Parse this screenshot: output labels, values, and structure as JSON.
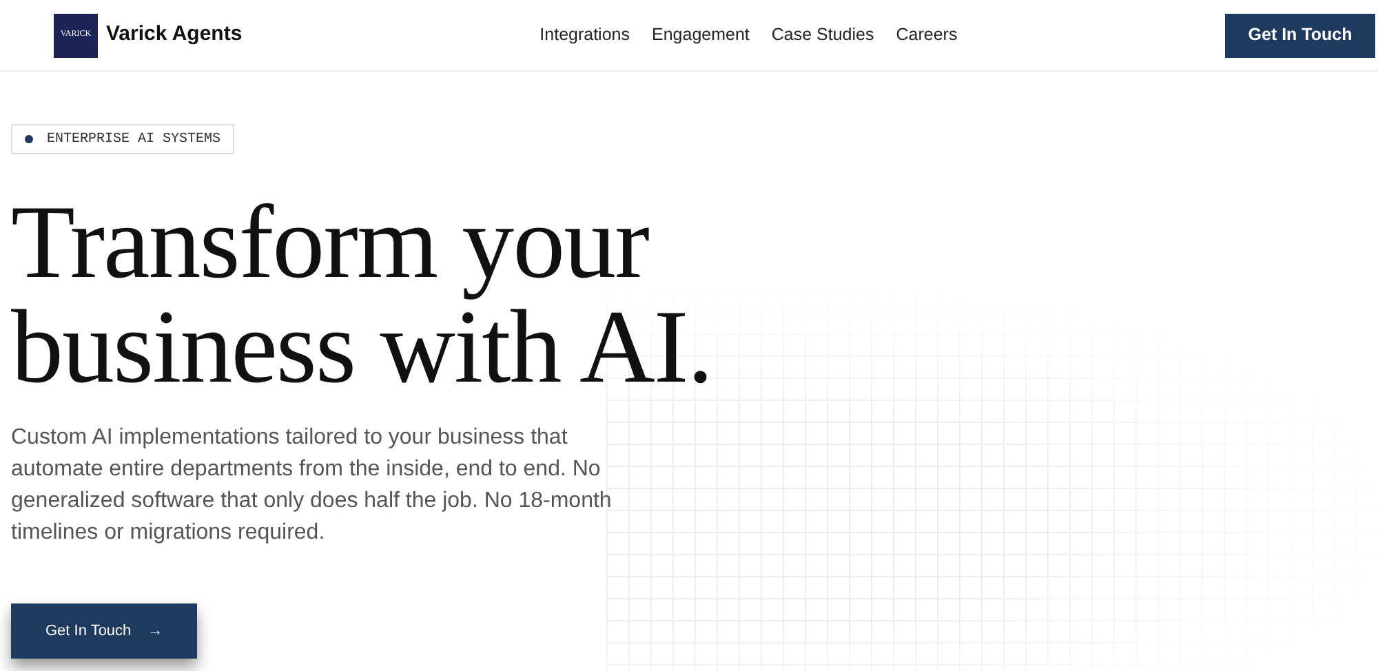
{
  "header": {
    "logo_text": "VARICK",
    "brand": "Varick Agents",
    "nav": [
      "Integrations",
      "Engagement",
      "Case Studies",
      "Careers"
    ],
    "cta": "Get In Touch"
  },
  "hero": {
    "badge": "ENTERPRISE AI SYSTEMS",
    "title_lines": [
      "Transform your",
      "business with AI."
    ],
    "description": "Custom AI implementations tailored to your business that automate entire departments from the inside, end to end. No generalized software that only does half the job. No 18-month timelines or migrations required.",
    "button": "Get In Touch",
    "button_arrow": "→"
  }
}
